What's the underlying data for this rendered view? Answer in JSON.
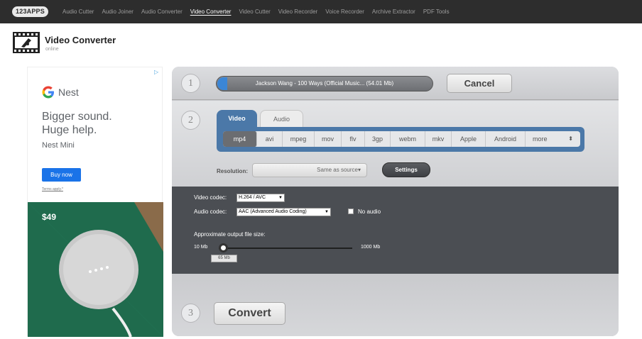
{
  "nav": {
    "logo": "123APPS",
    "links": [
      {
        "label": "Audio Cutter",
        "active": false
      },
      {
        "label": "Audio Joiner",
        "active": false
      },
      {
        "label": "Audio Converter",
        "active": false
      },
      {
        "label": "Video Converter",
        "active": true
      },
      {
        "label": "Video Cutter",
        "active": false
      },
      {
        "label": "Video Recorder",
        "active": false
      },
      {
        "label": "Voice Recorder",
        "active": false
      },
      {
        "label": "Archive Extractor",
        "active": false
      },
      {
        "label": "PDF Tools",
        "active": false
      }
    ]
  },
  "header": {
    "icon": "video-converter-icon",
    "title": "Video Converter",
    "subtitle": "online"
  },
  "ad": {
    "brand": "Nest",
    "headline": "Bigger sound.\nHuge help.",
    "product": "Nest Mini",
    "cta": "Buy now",
    "terms": "Terms apply.*",
    "price": "$49",
    "colors": {
      "cta": "#1a73e8",
      "photo_bg": "#1f6b4d"
    }
  },
  "converter": {
    "step1": {
      "number": "1",
      "file_label": "Jackson Wang - 100 Ways (Official Music... (54.01 Mb)",
      "cancel_label": "Cancel"
    },
    "step2": {
      "number": "2",
      "tabs": [
        {
          "label": "Video",
          "active": true
        },
        {
          "label": "Audio",
          "active": false
        }
      ],
      "formats": [
        "mp4",
        "avi",
        "mpeg",
        "mov",
        "flv",
        "3gp",
        "webm",
        "mkv",
        "Apple",
        "Android",
        "more"
      ],
      "selected_format": "mp4",
      "resolution_label": "Resolution:",
      "resolution_value": "Same as source",
      "settings_label": "Settings"
    },
    "settings": {
      "video_codec_label": "Video codec:",
      "video_codec_value": "H.264 / AVC",
      "audio_codec_label": "Audio codec:",
      "audio_codec_value": "AAC (Advanced Audio Coding)",
      "no_audio_label": "No audio",
      "no_audio_checked": false,
      "size_label": "Approximate output file size:",
      "size_min": "10 Mb",
      "size_max": "1000 Mb",
      "size_value": "65 Mb"
    },
    "step3": {
      "number": "3",
      "convert_label": "Convert"
    }
  },
  "colors": {
    "accent": "#4b78a8",
    "topbar": "#2d2d2d",
    "panel": "#4b4e53"
  }
}
